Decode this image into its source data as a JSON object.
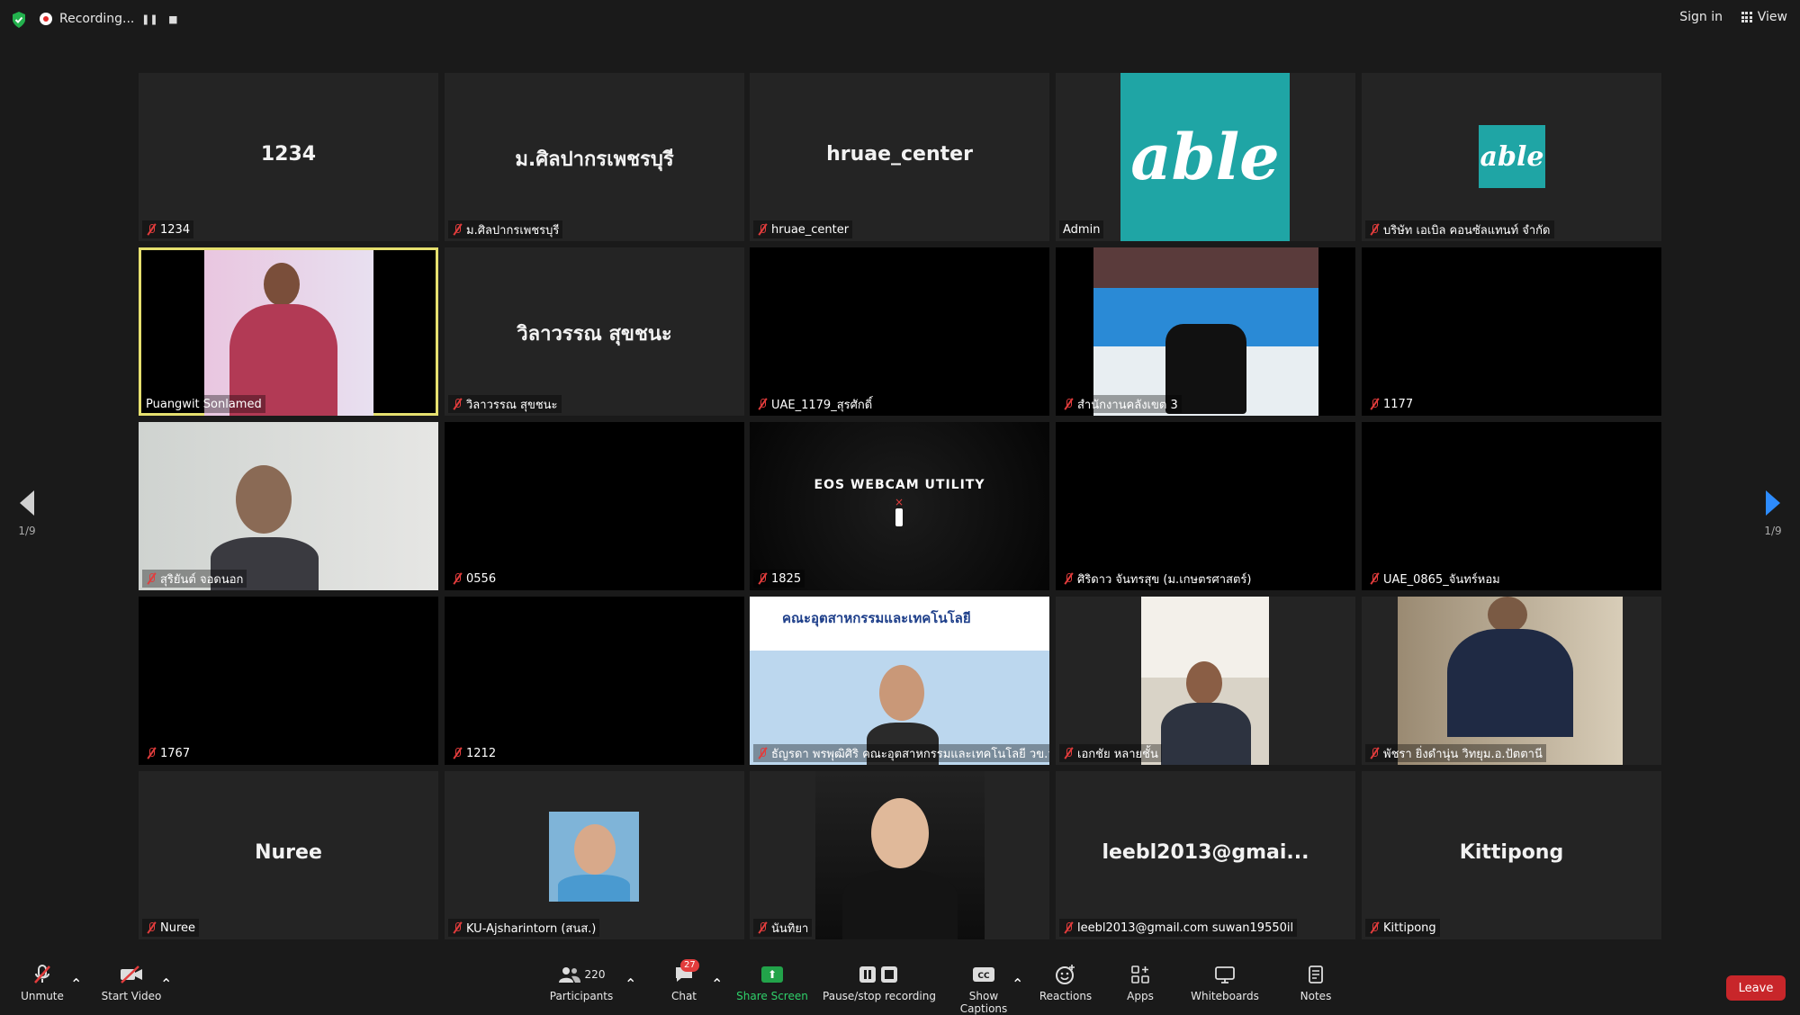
{
  "topbar": {
    "recording_label": "Recording...",
    "sign_in": "Sign in",
    "view": "View"
  },
  "pager": {
    "left": "1/9",
    "right": "1/9"
  },
  "tiles": [
    {
      "center": "1234",
      "label": "1234"
    },
    {
      "center": "ม.ศิลปากรเพชรบุรี",
      "label": "ม.ศิลปากรเพชรบุรี"
    },
    {
      "center": "hruae_center",
      "label": "hruae_center"
    },
    {
      "logo": "able",
      "label": "Admin"
    },
    {
      "logo": "able",
      "label": "บริษัท เอเบิล คอนซัลแทนท์ จำกัด"
    },
    {
      "label": "Puangwit Sonlamed"
    },
    {
      "center": "วิลาวรรณ สุขชนะ",
      "label": "วิลาวรรณ สุขชนะ"
    },
    {
      "label": "UAE_1179_สุรศักดิ์"
    },
    {
      "label": "สำนักงานคลังเขต 3"
    },
    {
      "label": "1177"
    },
    {
      "label": "สุริยันต์ จอดนอก"
    },
    {
      "label": "0556"
    },
    {
      "eos": "EOS WEBCAM UTILITY",
      "label": "1825"
    },
    {
      "label": "ศิริดาว จันทรสุข (ม.เกษตรศาสตร์)"
    },
    {
      "label": "UAE_0865_จันทร์หอม"
    },
    {
      "label": "1767"
    },
    {
      "label": "1212"
    },
    {
      "banner": "คณะอุตสาหกรรมและเทคโนโลยี",
      "label": "ธัญรดา พรพุฒิศิริ คณะอุตสาหกรรมและเทคโนโลยี วข.วก."
    },
    {
      "label": "เอกชัย หลายชั้น"
    },
    {
      "label": "พัชรา ยิ่งดำนุ่น วิทยุม.อ.ปัตตานี"
    },
    {
      "center": "Nuree",
      "label": "Nuree"
    },
    {
      "label": "KU-Ajsharintorn (สนส.)"
    },
    {
      "label": "นันทิยา"
    },
    {
      "center": "leebl2013@gmai...",
      "label": "leebl2013@gmail.com suwan19550il"
    },
    {
      "center": "Kittipong",
      "label": "Kittipong"
    }
  ],
  "toolbar": {
    "unmute": "Unmute",
    "start_video": "Start Video",
    "participants": "Participants",
    "participants_count": "220",
    "chat": "Chat",
    "chat_badge": "27",
    "share_screen": "Share Screen",
    "pause_recording": "Pause/stop recording",
    "show_captions": "Show Captions",
    "reactions": "Reactions",
    "apps": "Apps",
    "whiteboards": "Whiteboards",
    "notes": "Notes",
    "leave": "Leave"
  },
  "colors": {
    "active_speaker_border": "#e6e06f",
    "share_green": "#22a34a",
    "leave_red": "#c8262a",
    "muted_red": "#e23c3c",
    "able_teal": "#1fa5a5"
  }
}
